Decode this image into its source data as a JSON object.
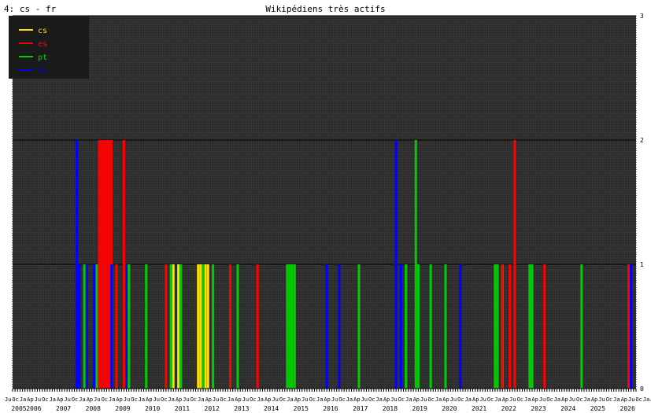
{
  "header": {
    "panel_label": "4: cs - fr",
    "title": "Wikipédiens très actifs"
  },
  "colors": {
    "background": "#333333",
    "grid": "#000000",
    "cs": "#ffdd00",
    "es": "#ff0000",
    "pt": "#00cc00",
    "fr": "#0000ff"
  },
  "chart_data": {
    "type": "bar",
    "title": "Wikipédiens très actifs",
    "ylim": [
      0,
      3
    ],
    "y_ticks": [
      "0",
      "1",
      "2",
      "3"
    ],
    "x_years": [
      "2005",
      "2006",
      "2007",
      "2008",
      "2009",
      "2010",
      "2011",
      "2012",
      "2013",
      "2014",
      "2015",
      "2016",
      "2017",
      "2018",
      "2019",
      "2020",
      "2021",
      "2022",
      "2023",
      "2024",
      "2025",
      "2026"
    ],
    "x_month_labels": [
      "Ju",
      "Oc",
      "Ja",
      "Ap",
      "Ju",
      "Oc",
      "Ja",
      "Ap",
      "Ju",
      "Oc",
      "Ja",
      "Ap",
      "Ju",
      "Oc",
      "Ja",
      "Ap",
      "Ju",
      "Oc",
      "Ja",
      "Ap",
      "Ju",
      "Oc",
      "Ja",
      "Ap",
      "Ju",
      "Oc",
      "Ja",
      "Ap",
      "Ju",
      "Oc",
      "Ja",
      "Ap",
      "Ju",
      "Oc",
      "Ja",
      "Ap",
      "Ju",
      "Oc",
      "Ja",
      "Ap",
      "Ju",
      "Oc",
      "Ja",
      "Ap",
      "Ju",
      "Oc",
      "Ja",
      "Ap",
      "Ju",
      "Oc",
      "Ja",
      "Ap",
      "Ju",
      "Oc",
      "Ja",
      "Ap",
      "Ju",
      "Oc",
      "Ja",
      "Ap",
      "Ju",
      "Oc",
      "Ja",
      "Ap",
      "Ju",
      "Oc",
      "Ja",
      "Ap",
      "Ju",
      "Oc",
      "Ja",
      "Ap",
      "Ju",
      "Oc",
      "Ja",
      "Ap",
      "Ju",
      "Oc",
      "Ja",
      "Ap",
      "Ju",
      "Oc",
      "Ja",
      "Ap",
      "Ju",
      "Oc",
      "Ja",
      "Ap",
      "Ju"
    ],
    "x_range": [
      "2005-07",
      "2026-07"
    ],
    "legend": {
      "position": "top-left",
      "entries": [
        "cs",
        "es",
        "pt",
        "fr"
      ]
    },
    "grid": true,
    "series": [
      {
        "name": "cs",
        "color": "#ffdd00",
        "points": [
          [
            "2010-12",
            1
          ],
          [
            "2011-02",
            1
          ],
          [
            "2011-10",
            1
          ],
          [
            "2011-11",
            1
          ],
          [
            "2012-01",
            1
          ],
          [
            "2012-02",
            1
          ],
          [
            "2022-01",
            1
          ],
          [
            "2023-01",
            1
          ]
        ]
      },
      {
        "name": "es",
        "color": "#ff0000",
        "points": [
          [
            "2008-06",
            2
          ],
          [
            "2008-07",
            2
          ],
          [
            "2008-08",
            2
          ],
          [
            "2008-09",
            2
          ],
          [
            "2008-10",
            2
          ],
          [
            "2008-11",
            2
          ],
          [
            "2009-01",
            1
          ],
          [
            "2009-04",
            2
          ],
          [
            "2010-09",
            1
          ],
          [
            "2012-11",
            1
          ],
          [
            "2013-10",
            1
          ],
          [
            "2021-11",
            1
          ],
          [
            "2022-01",
            1
          ],
          [
            "2022-04",
            1
          ],
          [
            "2022-06",
            2
          ],
          [
            "2023-06",
            1
          ],
          [
            "2026-04",
            1
          ]
        ]
      },
      {
        "name": "pt",
        "color": "#00cc00",
        "points": [
          [
            "2007-12",
            1
          ],
          [
            "2008-05",
            1
          ],
          [
            "2009-06",
            1
          ],
          [
            "2010-01",
            1
          ],
          [
            "2010-11",
            1
          ],
          [
            "2011-03",
            1
          ],
          [
            "2011-12",
            1
          ],
          [
            "2012-04",
            1
          ],
          [
            "2013-02",
            1
          ],
          [
            "2014-10",
            1
          ],
          [
            "2014-11",
            1
          ],
          [
            "2014-12",
            1
          ],
          [
            "2015-01",
            1
          ],
          [
            "2017-03",
            1
          ],
          [
            "2018-10",
            1
          ],
          [
            "2019-02",
            2
          ],
          [
            "2019-03",
            1
          ],
          [
            "2019-08",
            1
          ],
          [
            "2020-02",
            1
          ],
          [
            "2021-10",
            1
          ],
          [
            "2021-11",
            1
          ],
          [
            "2022-12",
            1
          ],
          [
            "2023-01",
            1
          ],
          [
            "2024-09",
            1
          ]
        ]
      },
      {
        "name": "fr",
        "color": "#0000ff",
        "points": [
          [
            "2007-09",
            2
          ],
          [
            "2007-10",
            1
          ],
          [
            "2008-01",
            1
          ],
          [
            "2008-04",
            1
          ],
          [
            "2008-11",
            1
          ],
          [
            "2009-05",
            1
          ],
          [
            "2016-02",
            1
          ],
          [
            "2016-07",
            1
          ],
          [
            "2018-06",
            2
          ],
          [
            "2018-08",
            1
          ],
          [
            "2020-08",
            1
          ],
          [
            "2026-05",
            1
          ]
        ]
      }
    ]
  }
}
